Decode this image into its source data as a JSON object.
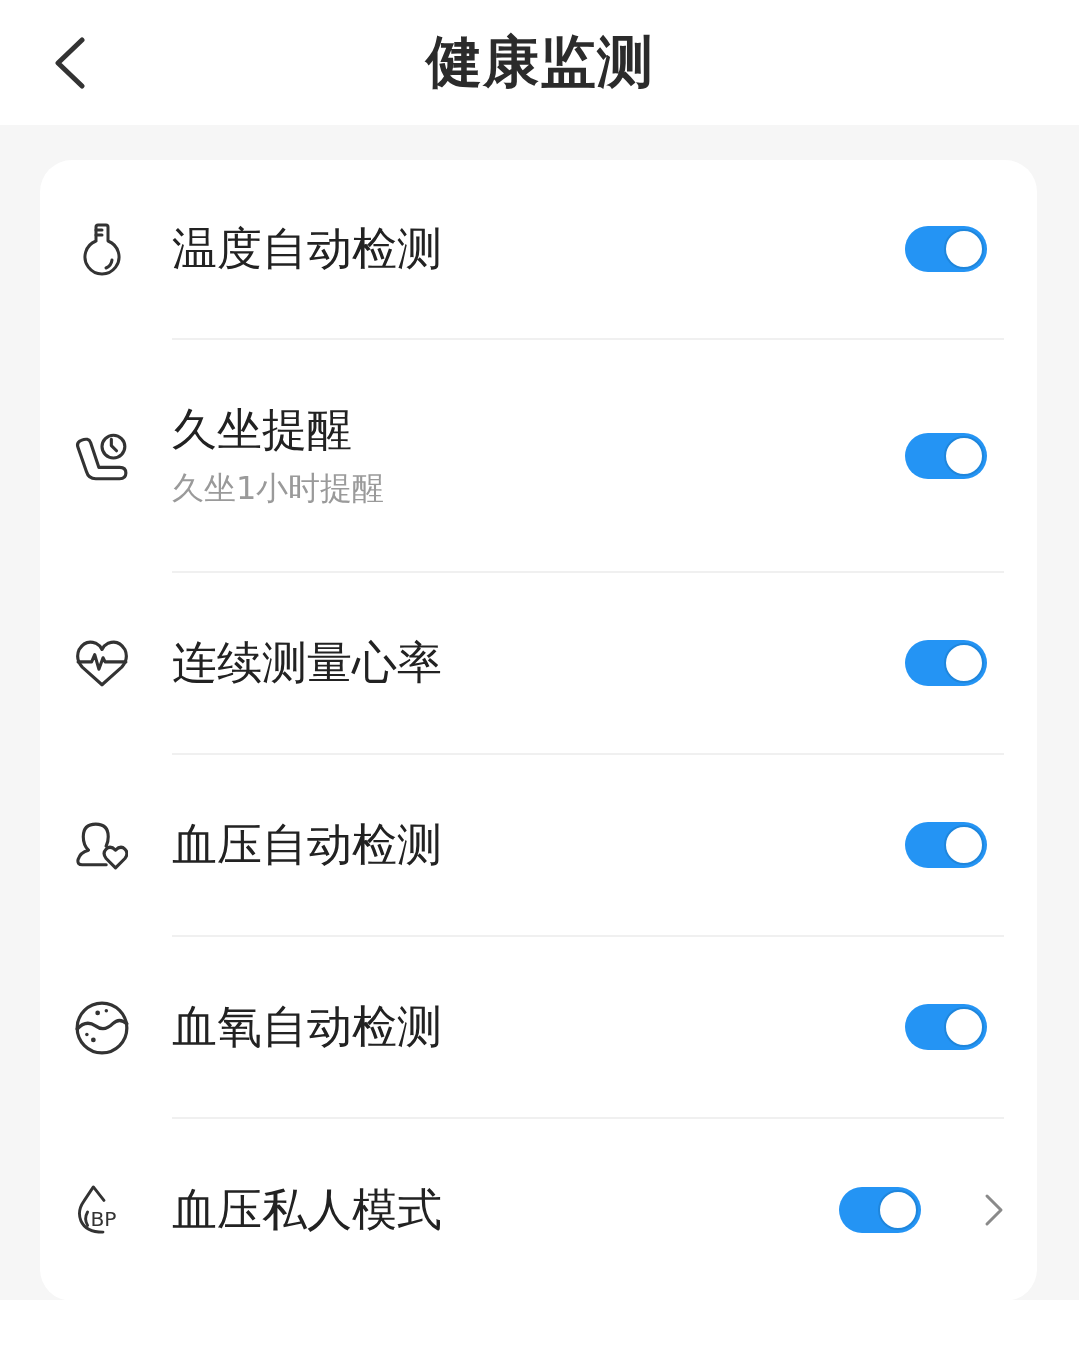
{
  "header": {
    "title": "健康监测"
  },
  "settings": [
    {
      "kind": "toggle",
      "label": "温度自动检测",
      "on": true
    },
    {
      "kind": "toggle",
      "label": "久坐提醒",
      "subtitle": "久坐1小时提醒",
      "on": true
    },
    {
      "kind": "toggle",
      "label": "连续测量心率",
      "on": true
    },
    {
      "kind": "toggle",
      "label": "血压自动检测",
      "on": true
    },
    {
      "kind": "toggle",
      "label": "血氧自动检测",
      "on": true
    },
    {
      "kind": "toggle_link",
      "label": "血压私人模式",
      "on": true,
      "icon_text": "BP"
    }
  ]
}
